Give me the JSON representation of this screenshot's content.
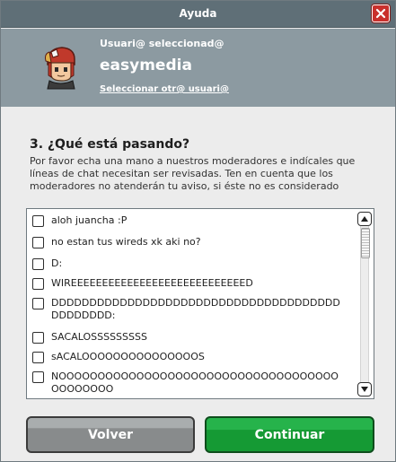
{
  "window": {
    "title": "Ayuda"
  },
  "user": {
    "label": "Usuari@ seleccionad@",
    "name": "easymedia",
    "change_link": "Seleccionar otr@ usuari@"
  },
  "question": {
    "heading": "3. ¿Qué está pasando?",
    "instructions": "Por favor echa una mano a nuestros moderadores e indícales que líneas de chat necesitan ser revisadas. Ten en cuenta que los moderadores no atenderán tu aviso, si éste no es considerado"
  },
  "chat_lines": [
    {
      "text": "aloh juancha :P",
      "checked": false
    },
    {
      "text": "no estan tus wireds xk aki no?",
      "checked": false
    },
    {
      "text": "D:",
      "checked": false
    },
    {
      "text": "WIREEEEEEEEEEEEEEEEEEEEEEEEEEEED",
      "checked": false
    },
    {
      "text": "DDDDDDDDDDDDDDDDDDDDDDDDDDDDDDDDDDDDDDDDDDDDDD:",
      "checked": false
    },
    {
      "text": "SACALOSSSSSSSSS",
      "checked": false
    },
    {
      "text": "sACALOOOOOOOOOOOOOOOS",
      "checked": false
    },
    {
      "text": "NOOOOOOOOOOOOOOOOOOOOOOOOOOOOOOOOOOOOOOOOOOOO",
      "checked": false
    }
  ],
  "buttons": {
    "back": "Volver",
    "continue": "Continuar"
  },
  "colors": {
    "titlebar": "#5f6f77",
    "user_panel": "#8c9aa1",
    "back_button": "#888b8c",
    "continue_button": "#159a34",
    "close_button": "#c9302c"
  },
  "icons": {
    "close": "close-x-icon",
    "avatar": "avatar-character-icon",
    "scroll_up": "arrow-up-icon",
    "scroll_down": "arrow-down-icon"
  }
}
